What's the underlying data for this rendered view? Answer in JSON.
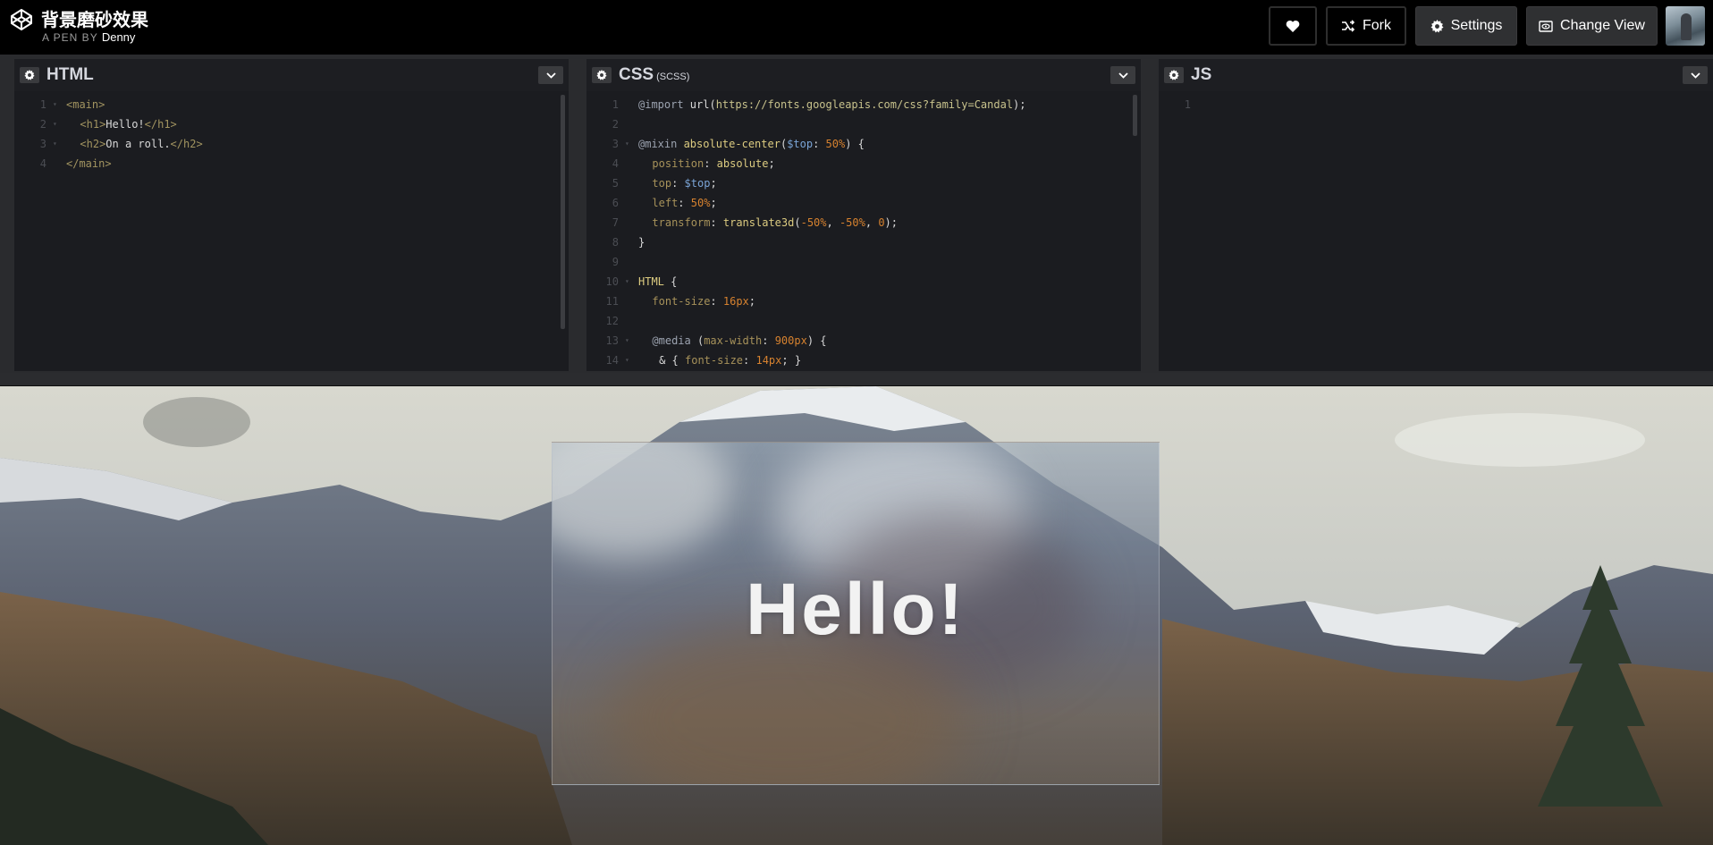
{
  "header": {
    "title": "背景磨砂效果",
    "byline_prefix": "A PEN BY",
    "author": "Denny",
    "fork_label": "Fork",
    "settings_label": "Settings",
    "change_view_label": "Change View"
  },
  "panes": {
    "html": {
      "title": "HTML"
    },
    "css": {
      "title": "CSS",
      "subtitle": "(SCSS)"
    },
    "js": {
      "title": "JS"
    }
  },
  "html_code": [
    {
      "n": "1",
      "fold": true,
      "parts": [
        [
          "tag",
          "<main>"
        ]
      ]
    },
    {
      "n": "2",
      "fold": true,
      "indent": 2,
      "parts": [
        [
          "tag",
          "<h1>"
        ],
        [
          "plain",
          "Hello!"
        ],
        [
          "tag",
          "</h1>"
        ]
      ]
    },
    {
      "n": "3",
      "fold": true,
      "indent": 2,
      "parts": [
        [
          "tag",
          "<h2>"
        ],
        [
          "plain",
          "On a roll."
        ],
        [
          "tag",
          "</h2>"
        ]
      ]
    },
    {
      "n": "4",
      "parts": [
        [
          "tag",
          "</main>"
        ]
      ]
    }
  ],
  "css_code": [
    {
      "n": "1",
      "parts": [
        [
          "kw",
          "@import"
        ],
        [
          "plain",
          " url("
        ],
        [
          "str",
          "https://fonts.googleapis.com/css?family=Candal"
        ],
        [
          "plain",
          ");"
        ]
      ]
    },
    {
      "n": "2",
      "parts": []
    },
    {
      "n": "3",
      "fold": true,
      "parts": [
        [
          "kw",
          "@mixin"
        ],
        [
          "fn",
          " absolute-center"
        ],
        [
          "plain",
          "("
        ],
        [
          "var",
          "$top"
        ],
        [
          "plain",
          ": "
        ],
        [
          "num",
          "50%"
        ],
        [
          "plain",
          ") {"
        ]
      ]
    },
    {
      "n": "4",
      "indent": 2,
      "parts": [
        [
          "prop",
          "position"
        ],
        [
          "plain",
          ": "
        ],
        [
          "fn",
          "absolute"
        ],
        [
          "plain",
          ";"
        ]
      ]
    },
    {
      "n": "5",
      "indent": 2,
      "parts": [
        [
          "prop",
          "top"
        ],
        [
          "plain",
          ": "
        ],
        [
          "var",
          "$top"
        ],
        [
          "plain",
          ";"
        ]
      ]
    },
    {
      "n": "6",
      "indent": 2,
      "parts": [
        [
          "prop",
          "left"
        ],
        [
          "plain",
          ": "
        ],
        [
          "num",
          "50%"
        ],
        [
          "plain",
          ";"
        ]
      ]
    },
    {
      "n": "7",
      "indent": 2,
      "parts": [
        [
          "prop",
          "transform"
        ],
        [
          "plain",
          ": "
        ],
        [
          "fn",
          "translate3d"
        ],
        [
          "plain",
          "("
        ],
        [
          "num",
          "-50%"
        ],
        [
          "plain",
          ", "
        ],
        [
          "num",
          "-50%"
        ],
        [
          "plain",
          ", "
        ],
        [
          "num",
          "0"
        ],
        [
          "plain",
          ");"
        ]
      ]
    },
    {
      "n": "8",
      "parts": [
        [
          "plain",
          "}"
        ]
      ]
    },
    {
      "n": "9",
      "parts": []
    },
    {
      "n": "10",
      "fold": true,
      "parts": [
        [
          "fn",
          "HTML"
        ],
        [
          "plain",
          " {"
        ]
      ]
    },
    {
      "n": "11",
      "indent": 2,
      "parts": [
        [
          "prop",
          "font-size"
        ],
        [
          "plain",
          ": "
        ],
        [
          "num",
          "16px"
        ],
        [
          "plain",
          ";"
        ]
      ]
    },
    {
      "n": "12",
      "parts": []
    },
    {
      "n": "13",
      "fold": true,
      "indent": 2,
      "parts": [
        [
          "kw",
          "@media"
        ],
        [
          "plain",
          " ("
        ],
        [
          "prop",
          "max-width"
        ],
        [
          "plain",
          ": "
        ],
        [
          "num",
          "900px"
        ],
        [
          "plain",
          ") {"
        ]
      ]
    },
    {
      "n": "14",
      "fold": true,
      "indent": 3,
      "parts": [
        [
          "plain",
          "& { "
        ],
        [
          "prop",
          "font-size"
        ],
        [
          "plain",
          ": "
        ],
        [
          "num",
          "14px"
        ],
        [
          "plain",
          "; }"
        ]
      ]
    }
  ],
  "js_code": [
    {
      "n": "1",
      "parts": []
    }
  ],
  "preview": {
    "heading": "Hello!"
  },
  "icons": {
    "logo": "codepen-logo-icon",
    "heart": "heart-icon",
    "fork": "fork-icon",
    "settings": "gear-icon",
    "change_view": "change-view-icon",
    "collapse": "chevron-down-icon"
  }
}
